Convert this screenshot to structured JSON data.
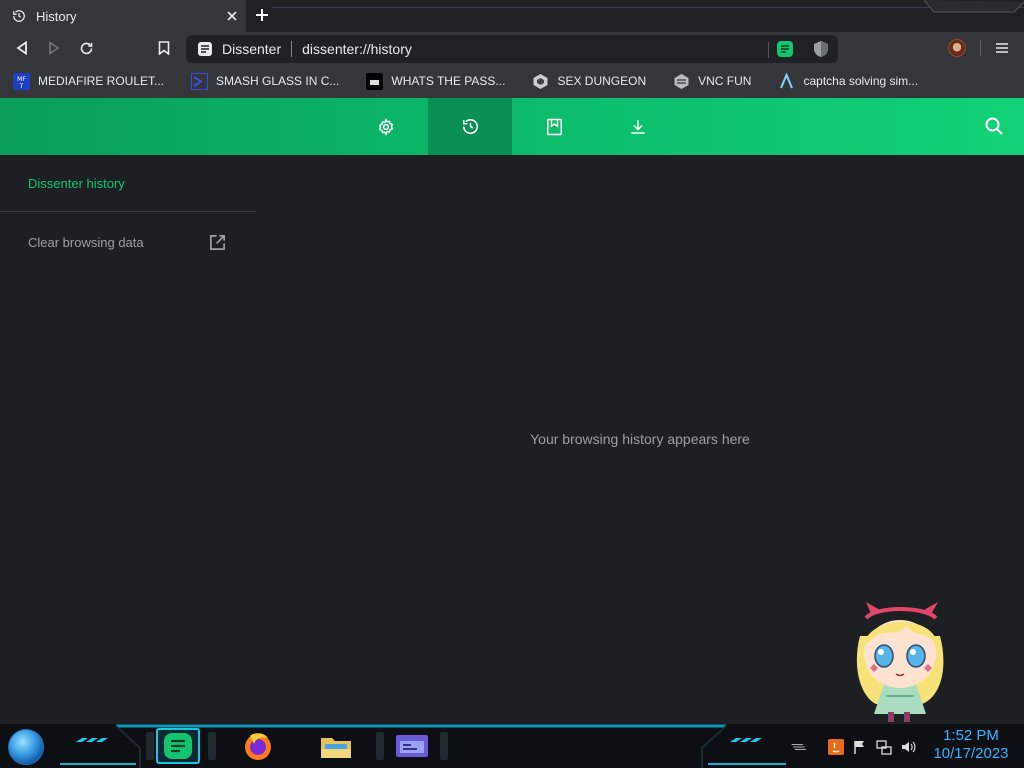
{
  "tab": {
    "title": "History"
  },
  "toolbar": {
    "site_name": "Dissenter",
    "url": "dissenter://history"
  },
  "bookmarks": [
    {
      "label": "MEDIAFIRE ROULET...",
      "icon": "mediafire-icon"
    },
    {
      "label": "SMASH GLASS IN C...",
      "icon": "chevron-icon"
    },
    {
      "label": "WHATS THE PASS...",
      "icon": "terminal-icon"
    },
    {
      "label": "SEX DUNGEON",
      "icon": "dungeon-icon"
    },
    {
      "label": "VNC FUN",
      "icon": "vnc-icon"
    },
    {
      "label": "captcha solving sim...",
      "icon": "lambda-icon"
    }
  ],
  "nav": {
    "items": [
      {
        "name": "settings",
        "icon": "gear-icon"
      },
      {
        "name": "history",
        "icon": "history-icon",
        "active": true
      },
      {
        "name": "bookmarks",
        "icon": "bookmark-icon"
      },
      {
        "name": "downloads",
        "icon": "download-icon"
      }
    ]
  },
  "sidebar": {
    "title": "Dissenter history",
    "clear_label": "Clear browsing data"
  },
  "main": {
    "empty_message": "Your browsing history appears here"
  },
  "taskbar": {
    "time": "1:52 PM",
    "date": "10/17/2023"
  },
  "colors": {
    "accent": "#0cbd6b",
    "page_bg": "#1e1f22",
    "clock": "#2fb5ff"
  }
}
